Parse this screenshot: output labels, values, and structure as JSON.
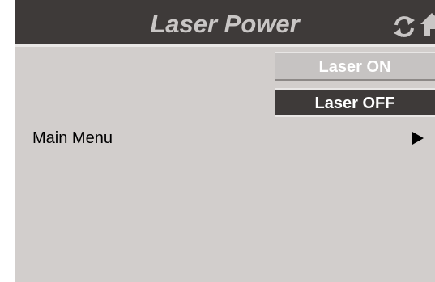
{
  "header": {
    "title": "Laser Power",
    "icons": [
      "refresh-icon",
      "home-icon"
    ]
  },
  "buttons": {
    "laser_on_label": "Laser ON",
    "laser_off_label": "Laser OFF"
  },
  "menu": {
    "main_menu_label": "Main Menu",
    "arrow_icon": "triangle-right-icon"
  },
  "colors": {
    "header_bg": "#3e3a39",
    "screen_bg": "#d2cecc",
    "button_on_bg": "#c6c3c2",
    "button_off_bg": "#3e3a39",
    "title_text": "#c9c6c5"
  }
}
